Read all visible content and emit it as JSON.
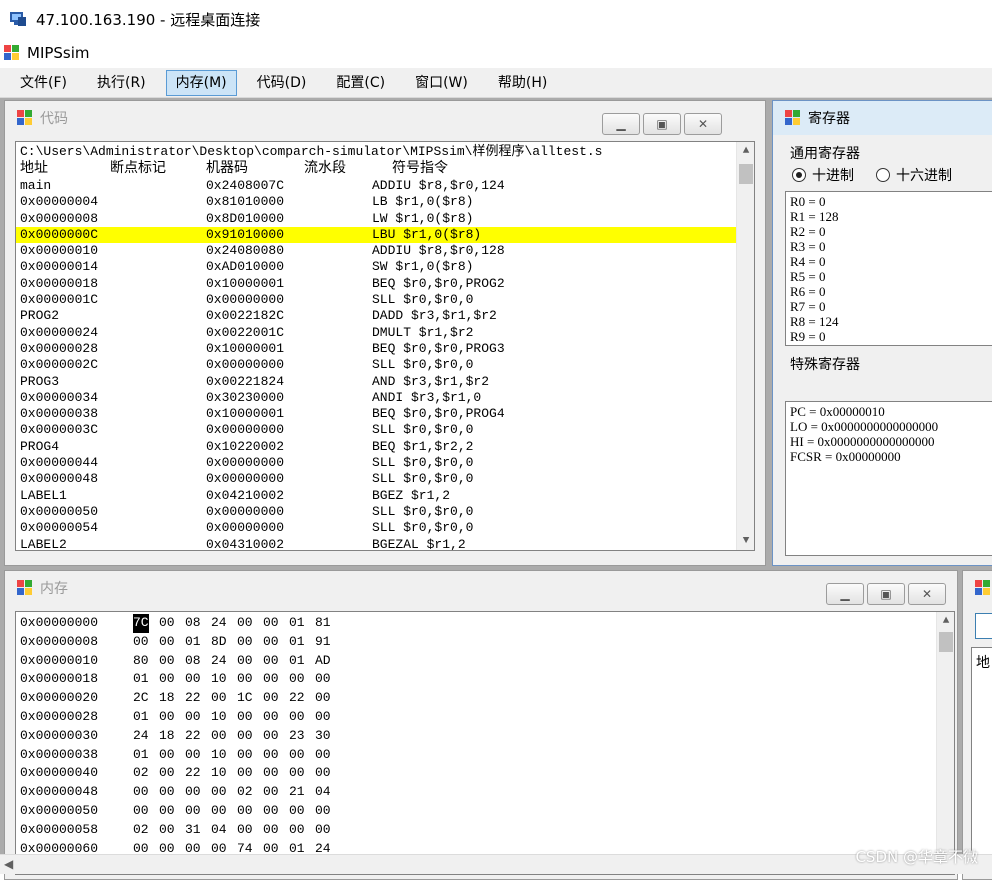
{
  "rdp": {
    "title": "47.100.163.190 - 远程桌面连接"
  },
  "app": {
    "title": "MIPSsim"
  },
  "menu": [
    "文件(F)",
    "执行(R)",
    "内存(M)",
    "代码(D)",
    "配置(C)",
    "窗口(W)",
    "帮助(H)"
  ],
  "menu_active": "内存(M)",
  "code_window": {
    "title": "代码",
    "path": "C:\\Users\\Administrator\\Desktop\\comparch-simulator\\MIPSsim\\样例程序\\alltest.s",
    "headers": {
      "addr": "地址",
      "bp": "断点标记",
      "mc": "机器码",
      "stage": "流水段",
      "instr": "符号指令"
    },
    "rows": [
      {
        "addr": "main",
        "mc": "0x2408007C",
        "instr": "ADDIU $r8,$r0,124"
      },
      {
        "addr": "0x00000004",
        "mc": "0x81010000",
        "instr": "LB $r1,0($r8)"
      },
      {
        "addr": "0x00000008",
        "mc": "0x8D010000",
        "instr": "LW $r1,0($r8)"
      },
      {
        "addr": "0x0000000C",
        "mc": "0x91010000",
        "instr": "LBU $r1,0($r8)",
        "highlight": true
      },
      {
        "addr": "0x00000010",
        "mc": "0x24080080",
        "instr": "ADDIU $r8,$r0,128"
      },
      {
        "addr": "0x00000014",
        "mc": "0xAD010000",
        "instr": "SW $r1,0($r8)"
      },
      {
        "addr": "0x00000018",
        "mc": "0x10000001",
        "instr": "BEQ $r0,$r0,PROG2"
      },
      {
        "addr": "0x0000001C",
        "mc": "0x00000000",
        "instr": "SLL $r0,$r0,0"
      },
      {
        "addr": "PROG2",
        "mc": "0x0022182C",
        "instr": "DADD $r3,$r1,$r2"
      },
      {
        "addr": "0x00000024",
        "mc": "0x0022001C",
        "instr": "DMULT $r1,$r2"
      },
      {
        "addr": "0x00000028",
        "mc": "0x10000001",
        "instr": "BEQ $r0,$r0,PROG3"
      },
      {
        "addr": "0x0000002C",
        "mc": "0x00000000",
        "instr": "SLL $r0,$r0,0"
      },
      {
        "addr": "PROG3",
        "mc": "0x00221824",
        "instr": "AND $r3,$r1,$r2"
      },
      {
        "addr": "0x00000034",
        "mc": "0x30230000",
        "instr": "ANDI $r3,$r1,0"
      },
      {
        "addr": "0x00000038",
        "mc": "0x10000001",
        "instr": "BEQ $r0,$r0,PROG4"
      },
      {
        "addr": "0x0000003C",
        "mc": "0x00000000",
        "instr": "SLL $r0,$r0,0"
      },
      {
        "addr": "PROG4",
        "mc": "0x10220002",
        "instr": "BEQ $r1,$r2,2"
      },
      {
        "addr": "0x00000044",
        "mc": "0x00000000",
        "instr": "SLL $r0,$r0,0"
      },
      {
        "addr": "0x00000048",
        "mc": "0x00000000",
        "instr": "SLL $r0,$r0,0"
      },
      {
        "addr": "LABEL1",
        "mc": "0x04210002",
        "instr": "BGEZ $r1,2"
      },
      {
        "addr": "0x00000050",
        "mc": "0x00000000",
        "instr": "SLL $r0,$r0,0"
      },
      {
        "addr": "0x00000054",
        "mc": "0x00000000",
        "instr": "SLL $r0,$r0,0"
      },
      {
        "addr": "LABEL2",
        "mc": "0x04310002",
        "instr": "BGEZAL $r1,2"
      }
    ]
  },
  "register_window": {
    "title": "寄存器",
    "gpr_label": "通用寄存器",
    "radio_dec": "十进制",
    "radio_hex": "十六进制",
    "gpr": [
      "R0 = 0",
      "R1 = 128",
      "R2 = 0",
      "R3 = 0",
      "R4 = 0",
      "R5 = 0",
      "R6 = 0",
      "R7 = 0",
      "R8 = 124",
      "R9 = 0"
    ],
    "special_label": "特殊寄存器",
    "special": [
      "PC = 0x00000010",
      "LO = 0x0000000000000000",
      "HI = 0x0000000000000000",
      "FCSR = 0x00000000"
    ]
  },
  "memory_window": {
    "title": "内存",
    "rows": [
      {
        "addr": "0x00000000",
        "bytes": [
          "7C",
          "00",
          "08",
          "24",
          "00",
          "00",
          "01",
          "81"
        ],
        "selected": 0
      },
      {
        "addr": "0x00000008",
        "bytes": [
          "00",
          "00",
          "01",
          "8D",
          "00",
          "00",
          "01",
          "91"
        ]
      },
      {
        "addr": "0x00000010",
        "bytes": [
          "80",
          "00",
          "08",
          "24",
          "00",
          "00",
          "01",
          "AD"
        ]
      },
      {
        "addr": "0x00000018",
        "bytes": [
          "01",
          "00",
          "00",
          "10",
          "00",
          "00",
          "00",
          "00"
        ]
      },
      {
        "addr": "0x00000020",
        "bytes": [
          "2C",
          "18",
          "22",
          "00",
          "1C",
          "00",
          "22",
          "00"
        ]
      },
      {
        "addr": "0x00000028",
        "bytes": [
          "01",
          "00",
          "00",
          "10",
          "00",
          "00",
          "00",
          "00"
        ]
      },
      {
        "addr": "0x00000030",
        "bytes": [
          "24",
          "18",
          "22",
          "00",
          "00",
          "00",
          "23",
          "30"
        ]
      },
      {
        "addr": "0x00000038",
        "bytes": [
          "01",
          "00",
          "00",
          "10",
          "00",
          "00",
          "00",
          "00"
        ]
      },
      {
        "addr": "0x00000040",
        "bytes": [
          "02",
          "00",
          "22",
          "10",
          "00",
          "00",
          "00",
          "00"
        ]
      },
      {
        "addr": "0x00000048",
        "bytes": [
          "00",
          "00",
          "00",
          "00",
          "02",
          "00",
          "21",
          "04"
        ]
      },
      {
        "addr": "0x00000050",
        "bytes": [
          "00",
          "00",
          "00",
          "00",
          "00",
          "00",
          "00",
          "00"
        ]
      },
      {
        "addr": "0x00000058",
        "bytes": [
          "02",
          "00",
          "31",
          "04",
          "00",
          "00",
          "00",
          "00"
        ]
      },
      {
        "addr": "0x00000060",
        "bytes": [
          "00",
          "00",
          "00",
          "00",
          "74",
          "00",
          "01",
          "24"
        ]
      }
    ]
  },
  "fourth_window": {
    "label": "地"
  },
  "watermark": "CSDN @华章不微"
}
